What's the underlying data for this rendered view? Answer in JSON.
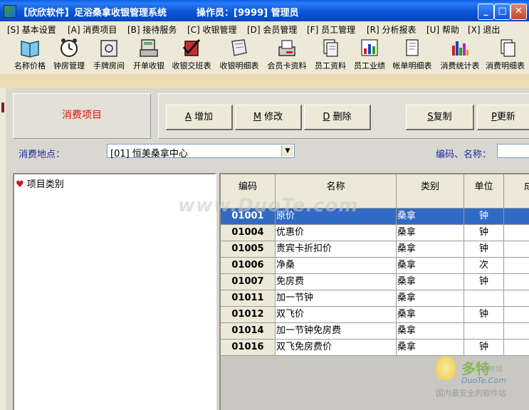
{
  "window": {
    "title": "【欣欣软件】足浴桑拿收银管理系统",
    "operator_text": "操作员：[9999] 管理员",
    "minimize": "_",
    "maximize": "□",
    "close": "✕"
  },
  "menu": [
    "[S] 基本设置",
    "[A] 消费项目",
    "[B] 接待服务",
    "[C] 收银管理",
    "[D] 会员管理",
    "[F] 员工管理",
    "[R] 分析报表",
    "[U] 帮助",
    "[X] 退出"
  ],
  "toolbar": [
    {
      "label": "名称价格",
      "icon": "book-icon"
    },
    {
      "label": "钟房管理",
      "icon": "alarm-clock-icon"
    },
    {
      "label": "手牌房间",
      "icon": "safe-icon"
    },
    {
      "label": "开单收银",
      "icon": "cash-register-icon"
    },
    {
      "label": "收银交班表",
      "icon": "checkmark-book-icon"
    },
    {
      "label": "收银明细表",
      "icon": "scroll-icon"
    },
    {
      "label": "会员卡资料",
      "icon": "card-printer-icon"
    },
    {
      "label": "员工资料",
      "icon": "documents-icon"
    },
    {
      "label": "员工业绩",
      "icon": "bar-chart-icon"
    },
    {
      "label": "帐单明细表",
      "icon": "receipt-icon"
    },
    {
      "label": "消费统计表",
      "icon": "color-bars-icon"
    },
    {
      "label": "消费明细表",
      "icon": "document-stack-icon"
    }
  ],
  "panel": {
    "title": "消费项目",
    "buttons": {
      "add": {
        "key": "A",
        "label": "增加"
      },
      "edit": {
        "key": "M",
        "label": "修改"
      },
      "delete": {
        "key": "D",
        "label": "删除"
      },
      "copy": {
        "key": "S",
        "label": "复制"
      },
      "update": {
        "key": "P",
        "label": "更新"
      }
    },
    "location_label": "消费地点：",
    "location_value": "[01] 恒美桑拿中心",
    "search_label": "编码、名称：",
    "search_value": ""
  },
  "tree": {
    "root": "项目类别"
  },
  "table": {
    "columns": [
      "编码",
      "名称",
      "类别",
      "单位",
      "成"
    ],
    "rows": [
      [
        "01001",
        "原价",
        "桑拿",
        "钟"
      ],
      [
        "01004",
        "优惠价",
        "桑拿",
        "钟"
      ],
      [
        "01005",
        "贵宾卡折扣价",
        "桑拿",
        "钟"
      ],
      [
        "01006",
        "净桑",
        "桑拿",
        "次"
      ],
      [
        "01007",
        "免房费",
        "桑拿",
        "钟"
      ],
      [
        "01011",
        "加一节钟",
        "桑拿",
        ""
      ],
      [
        "01012",
        "双飞价",
        "桑拿",
        "钟"
      ],
      [
        "01014",
        "加一节钟免房费",
        "桑拿",
        ""
      ],
      [
        "01016",
        "双飞免房费价",
        "桑拿",
        "钟"
      ]
    ],
    "selected_row": 0
  },
  "watermarks": {
    "center": "www.DuoTe.com",
    "brand": "多特",
    "brand_sub": "软件站",
    "brand_url": "DuoTe.Com",
    "brand_tag": "国内最安全的软件站"
  },
  "colors": {
    "title_bar": "#0A55D8",
    "selection": "#316AC5",
    "panel_title": "#E01010",
    "label_blue": "#1F28A0"
  }
}
